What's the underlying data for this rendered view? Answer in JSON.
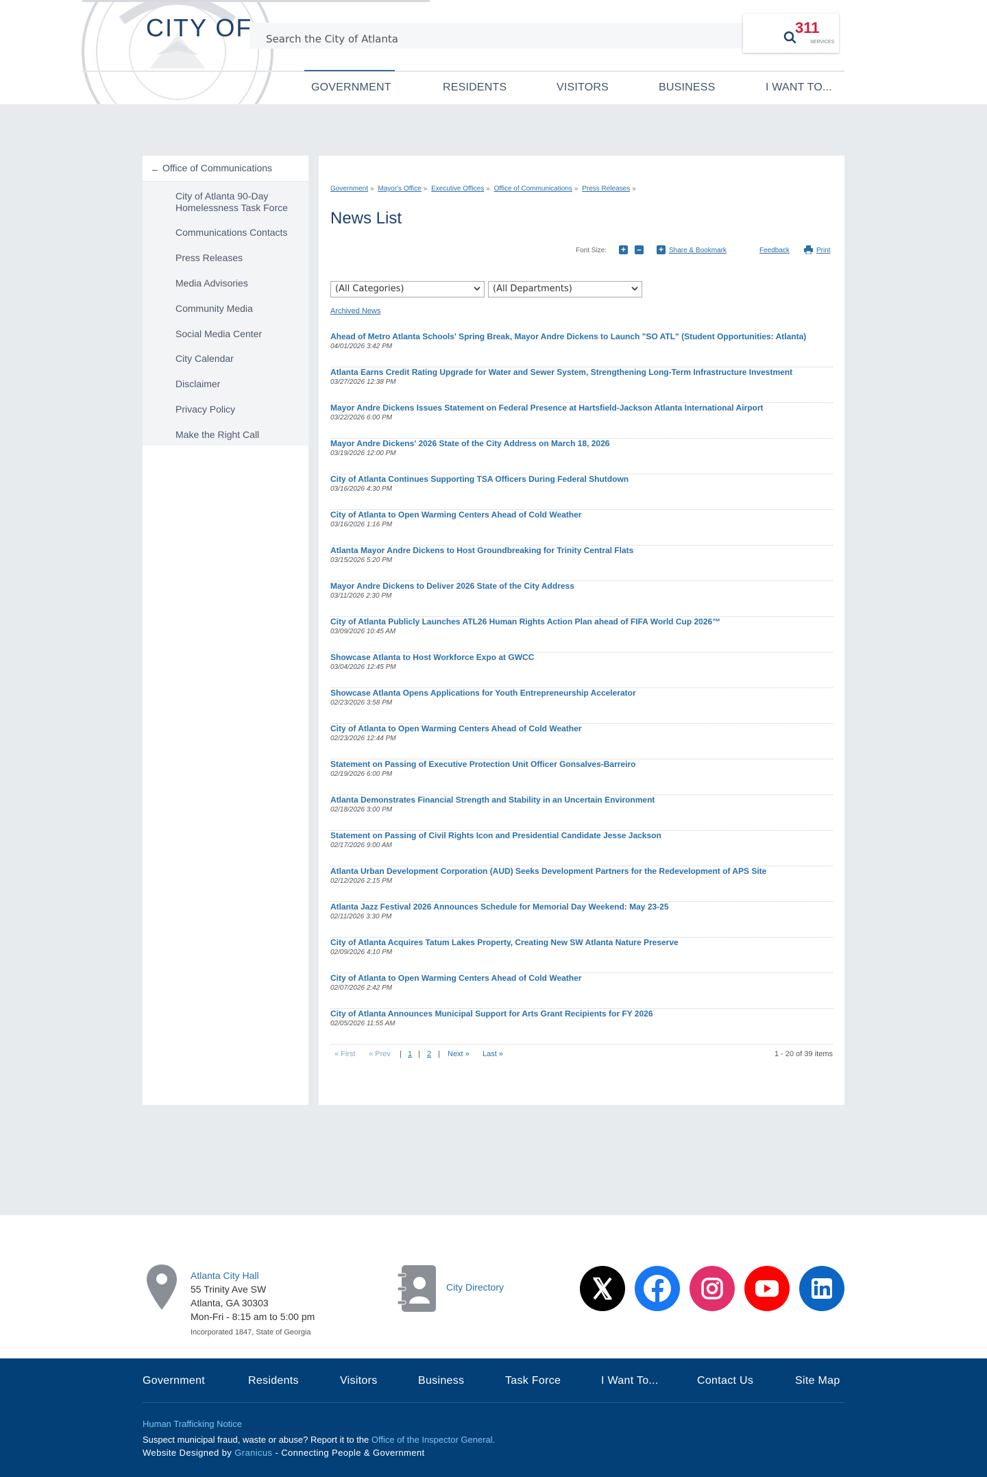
{
  "header": {
    "site_title": "CITY OF",
    "search_placeholder": "Search the City of Atlanta",
    "logo311": "311",
    "logo311_sub": "SERVICES",
    "nav": [
      "GOVERNMENT",
      "RESIDENTS",
      "VISITORS",
      "BUSINESS",
      "I WANT TO..."
    ]
  },
  "sidebar": {
    "heading": "Office of Communications",
    "items": [
      "City of Atlanta 90-Day Homelessness Task Force",
      "Communications Contacts",
      "Press Releases",
      "Media Advisories",
      "Community Media",
      "Social Media Center",
      "City Calendar",
      "Disclaimer",
      "Privacy Policy",
      "Make the Right Call"
    ]
  },
  "breadcrumb": [
    "Government",
    "Mayor's Office",
    "Executive Offices",
    "Office of Communications",
    "Press Releases"
  ],
  "breadcrumb_sep": "»",
  "page_title": "News List",
  "tools": {
    "font_size_label": "Font Size:",
    "share_label": "Share & Bookmark",
    "feedback_label": "Feedback",
    "print_label": "Print"
  },
  "filters": {
    "categories": "(All Categories)",
    "departments": "(All Departments)",
    "archived": "Archived News"
  },
  "news": [
    {
      "title": "Ahead of Metro Atlanta Schools' Spring Break, Mayor Andre Dickens to Launch \"SO ATL\" (Student Opportunities: Atlanta)",
      "date": "04/01/2026 3:42 PM"
    },
    {
      "title": "Atlanta Earns Credit Rating Upgrade for Water and Sewer System, Strengthening Long-Term Infrastructure Investment",
      "date": "03/27/2026 12:38 PM"
    },
    {
      "title": "Mayor Andre Dickens Issues Statement on Federal Presence at Hartsfield-Jackson Atlanta International Airport",
      "date": "03/22/2026 6:00 PM"
    },
    {
      "title": "Mayor Andre Dickens' 2026 State of the City Address on March 18, 2026",
      "date": "03/19/2026 12:00 PM"
    },
    {
      "title": "City of Atlanta Continues Supporting TSA Officers During Federal Shutdown",
      "date": "03/16/2026 4:30 PM"
    },
    {
      "title": "City of Atlanta to Open Warming Centers Ahead of Cold Weather",
      "date": "03/16/2026 1:16 PM"
    },
    {
      "title": "Atlanta Mayor Andre Dickens to Host Groundbreaking for Trinity Central Flats",
      "date": "03/15/2026 5:20 PM"
    },
    {
      "title": "Mayor Andre Dickens to Deliver 2026 State of the City Address",
      "date": "03/11/2026 2:30 PM"
    },
    {
      "title": "City of Atlanta Publicly Launches ATL26 Human Rights Action Plan ahead of FIFA World Cup 2026™",
      "date": "03/09/2026 10:45 AM"
    },
    {
      "title": "Showcase Atlanta to Host Workforce Expo at GWCC",
      "date": "03/04/2026 12:45 PM"
    },
    {
      "title": "Showcase Atlanta Opens Applications for Youth Entrepreneurship Accelerator",
      "date": "02/23/2026 3:58 PM"
    },
    {
      "title": "City of Atlanta to Open Warming Centers Ahead of Cold Weather",
      "date": "02/23/2026 12:44 PM"
    },
    {
      "title": "Statement on Passing of Executive Protection Unit Officer Gonsalves-Barreiro",
      "date": "02/19/2026 6:00 PM"
    },
    {
      "title": "Atlanta Demonstrates Financial Strength and Stability in an Uncertain Environment",
      "date": "02/18/2026 3:00 PM"
    },
    {
      "title": "Statement on Passing of Civil Rights Icon and Presidential Candidate Jesse Jackson",
      "date": "02/17/2026 9:00 AM"
    },
    {
      "title": "Atlanta Urban Development Corporation (AUD) Seeks Development Partners for the Redevelopment of APS Site",
      "date": "02/12/2026 2:15 PM"
    },
    {
      "title": "Atlanta Jazz Festival 2026 Announces Schedule for Memorial Day Weekend: May 23-25",
      "date": "02/11/2026 3:30 PM"
    },
    {
      "title": "City of Atlanta Acquires Tatum Lakes Property, Creating New SW Atlanta Nature Preserve",
      "date": "02/09/2026 4:10 PM"
    },
    {
      "title": "City of Atlanta to Open Warming Centers Ahead of Cold Weather",
      "date": "02/07/2026 2:42 PM"
    },
    {
      "title": "City of Atlanta Announces Municipal Support for Arts Grant Recipients for FY 2026",
      "date": "02/05/2026 11:55 AM"
    }
  ],
  "pager": {
    "first": "« First",
    "prev": "« Prev",
    "sep": "|",
    "pages": [
      "1",
      "2"
    ],
    "next": "Next »",
    "last": "Last »",
    "count": "1 - 20 of 39 items"
  },
  "footer": {
    "address": {
      "name": "Atlanta City Hall",
      "street": "55 Trinity Ave SW",
      "city": "Atlanta, GA 30303",
      "hours": "Mon-Fri - 8:15 am to 5:00 pm",
      "incorporated": "Incorporated 1847, State of Georgia"
    },
    "directory": "City Directory",
    "social": [
      {
        "icon": "x-icon",
        "color": "#000000"
      },
      {
        "icon": "facebook-icon",
        "color": "#1877f2"
      },
      {
        "icon": "instagram-icon",
        "color": "#e1306c"
      },
      {
        "icon": "youtube-icon",
        "color": "#ff0000"
      },
      {
        "icon": "linkedin-icon",
        "color": "#0a66c2"
      }
    ],
    "nav": [
      "Government",
      "Residents",
      "Visitors",
      "Business",
      "Task Force",
      "I Want To...",
      "Contact Us",
      "Site Map"
    ],
    "trafficking": "Human Trafficking Notice",
    "fraud_text": "Suspect municipal fraud, waste or abuse? Report it to the",
    "fraud_link": "Office of the Inspector General.",
    "designed_text": "Website Designed by",
    "designed_link": "Granicus",
    "designed_suffix": "- Connecting People & Government"
  },
  "colors": {
    "brand_navy": "#034077",
    "link_blue": "#2b6fa8",
    "page_bg": "#e8ebee"
  }
}
